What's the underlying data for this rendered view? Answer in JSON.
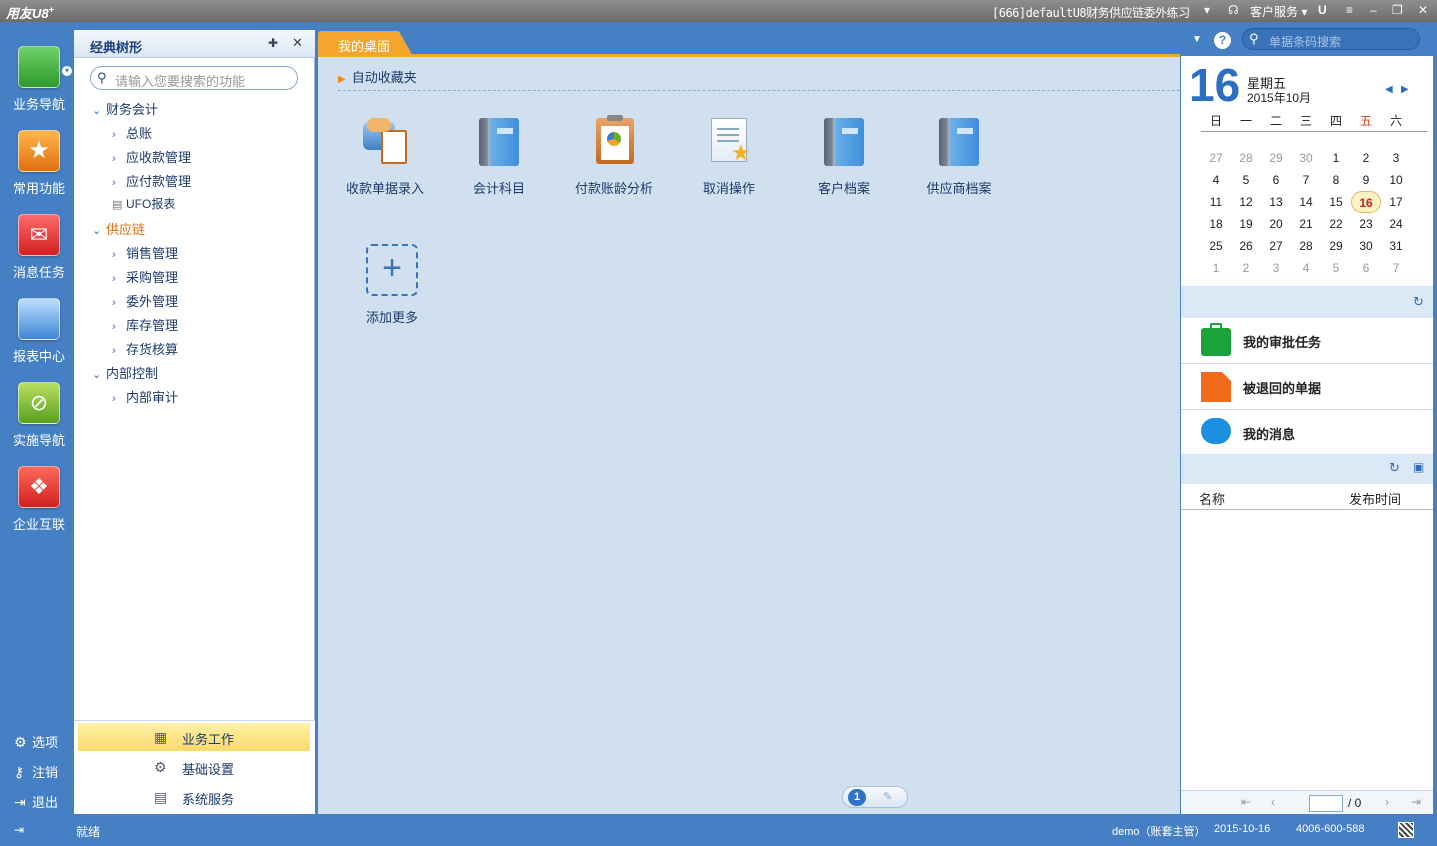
{
  "titlebar": {
    "logo": "用友U8",
    "logo_sup": "+",
    "account": "[666]defaultU8财务供应链委外练习",
    "customer_service": "客户服务",
    "min": "–",
    "restore": "❐",
    "close": "✕"
  },
  "leftnav": {
    "items": [
      {
        "label": "业务导航",
        "icon": "business-nav-icon",
        "color": "#3aa43a"
      },
      {
        "label": "常用功能",
        "icon": "star-icon",
        "color": "#f08b16"
      },
      {
        "label": "消息任务",
        "icon": "message-icon",
        "color": "#e23b3b"
      },
      {
        "label": "报表中心",
        "icon": "report-icon",
        "color": "#4a8fd6"
      },
      {
        "label": "实施导航",
        "icon": "compass-icon",
        "color": "#6ab026"
      },
      {
        "label": "企业互联",
        "icon": "enterprise-icon",
        "color": "#e03030"
      }
    ],
    "bottom": [
      {
        "label": "选项",
        "icon": "gear-icon"
      },
      {
        "label": "注销",
        "icon": "key-icon"
      },
      {
        "label": "退出",
        "icon": "exit-icon"
      }
    ]
  },
  "tree": {
    "title": "经典树形",
    "search_placeholder": "请输入您要搜索的功能",
    "nodes": [
      {
        "label": "财务会计",
        "level": 0,
        "expanded": true
      },
      {
        "label": "总账",
        "level": 1
      },
      {
        "label": "应收款管理",
        "level": 1
      },
      {
        "label": "应付款管理",
        "level": 1
      },
      {
        "label": "UFO报表",
        "level": 1,
        "leaf": true
      },
      {
        "label": "供应链",
        "level": 0,
        "expanded": true,
        "highlight": true
      },
      {
        "label": "销售管理",
        "level": 1
      },
      {
        "label": "采购管理",
        "level": 1
      },
      {
        "label": "委外管理",
        "level": 1
      },
      {
        "label": "库存管理",
        "level": 1
      },
      {
        "label": "存货核算",
        "level": 1
      },
      {
        "label": "内部控制",
        "level": 0,
        "expanded": true
      },
      {
        "label": "内部审计",
        "level": 1
      }
    ],
    "bottom_menu": [
      {
        "label": "业务工作",
        "selected": true
      },
      {
        "label": "基础设置"
      },
      {
        "label": "系统服务"
      }
    ]
  },
  "main": {
    "tab": "我的桌面",
    "search_placeholder": "单据条码搜索",
    "fav_title": "自动收藏夹",
    "favorites": [
      "收款单据录入",
      "会计科目",
      "付款账龄分析",
      "取消操作",
      "客户档案",
      "供应商档案"
    ],
    "add_more": "添加更多",
    "add_more_glyph": "+",
    "page": "1"
  },
  "calendar": {
    "day": "16",
    "weekday": "星期五",
    "month_year": "2015年10月",
    "headers": [
      "日",
      "一",
      "二",
      "三",
      "四",
      "五",
      "六"
    ],
    "weeks": [
      [
        "27",
        "28",
        "29",
        "30",
        "1",
        "2",
        "3"
      ],
      [
        "4",
        "5",
        "6",
        "7",
        "8",
        "9",
        "10"
      ],
      [
        "11",
        "12",
        "13",
        "14",
        "15",
        "16",
        "17"
      ],
      [
        "18",
        "19",
        "20",
        "21",
        "22",
        "23",
        "24"
      ],
      [
        "25",
        "26",
        "27",
        "28",
        "29",
        "30",
        "31"
      ],
      [
        "1",
        "2",
        "3",
        "4",
        "5",
        "6",
        "7"
      ]
    ]
  },
  "tasks": [
    {
      "label": "我的审批任务",
      "icon": "briefcase-icon",
      "color": "#1aa33a"
    },
    {
      "label": "被退回的单据",
      "icon": "document-icon",
      "color": "#f26a1b"
    },
    {
      "label": "我的消息",
      "icon": "chat-bubble-icon",
      "color": "#1a8fe0"
    }
  ],
  "list": {
    "col_name": "名称",
    "col_time": "发布时间",
    "page_total": "/ 0"
  },
  "status": {
    "ready": "就绪",
    "user": "demo（账套主管）",
    "date": "2015-10-16",
    "phone": "4006-600-588"
  }
}
